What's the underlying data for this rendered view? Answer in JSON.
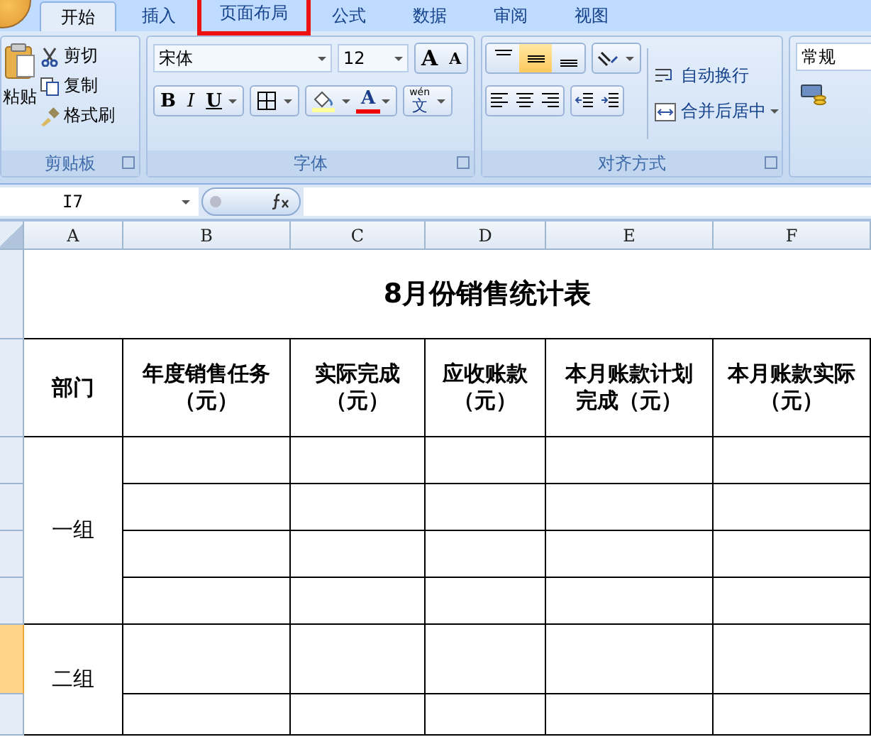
{
  "tabs": [
    {
      "label": "开始",
      "selected": true,
      "highlighted": false
    },
    {
      "label": "插入",
      "selected": false,
      "highlighted": false
    },
    {
      "label": "页面布局",
      "selected": false,
      "highlighted": true
    },
    {
      "label": "公式",
      "selected": false,
      "highlighted": false
    },
    {
      "label": "数据",
      "selected": false,
      "highlighted": false
    },
    {
      "label": "审阅",
      "selected": false,
      "highlighted": false
    },
    {
      "label": "视图",
      "selected": false,
      "highlighted": false
    }
  ],
  "clipboard": {
    "title": "剪贴板",
    "paste": "粘贴",
    "commands": [
      {
        "kind": "cut",
        "label": "剪切"
      },
      {
        "kind": "copy",
        "label": "复制"
      },
      {
        "kind": "painter",
        "label": "格式刷"
      }
    ]
  },
  "font": {
    "title": "字体",
    "font_name": "宋体",
    "font_size": "12",
    "grow": "A",
    "shrink": "A",
    "bold": "B",
    "italic": "I",
    "underline": "U",
    "font_color": "A",
    "phonetic_top": "wén",
    "phonetic": "文"
  },
  "alignment": {
    "title": "对齐方式",
    "vertical": [
      {
        "kind": "top",
        "selected": false
      },
      {
        "kind": "middle",
        "selected": true
      },
      {
        "kind": "bottom",
        "selected": false
      }
    ],
    "wrap": "自动换行",
    "merge": "合并后居中"
  },
  "number": {
    "format": "常规"
  },
  "formula_bar": {
    "name_box": "I7"
  },
  "sheet": {
    "columns": [
      "A",
      "B",
      "C",
      "D",
      "E",
      "F"
    ],
    "rows": [
      {
        "selected": false
      },
      {
        "selected": false
      },
      {
        "selected": false
      },
      {
        "selected": false
      },
      {
        "selected": false
      },
      {
        "selected": false
      },
      {
        "selected": true
      },
      {
        "selected": false
      }
    ],
    "title": "8月份销售统计表",
    "headers": [
      [
        "部门"
      ],
      [
        "年度销售任务",
        "（元）"
      ],
      [
        "实际完成",
        "（元）"
      ],
      [
        "应收账款",
        "（元）"
      ],
      [
        "本月账款计划",
        "完成（元）"
      ],
      [
        "本月账款实际",
        "（元）"
      ]
    ],
    "groups": [
      "一组",
      "二组"
    ]
  }
}
